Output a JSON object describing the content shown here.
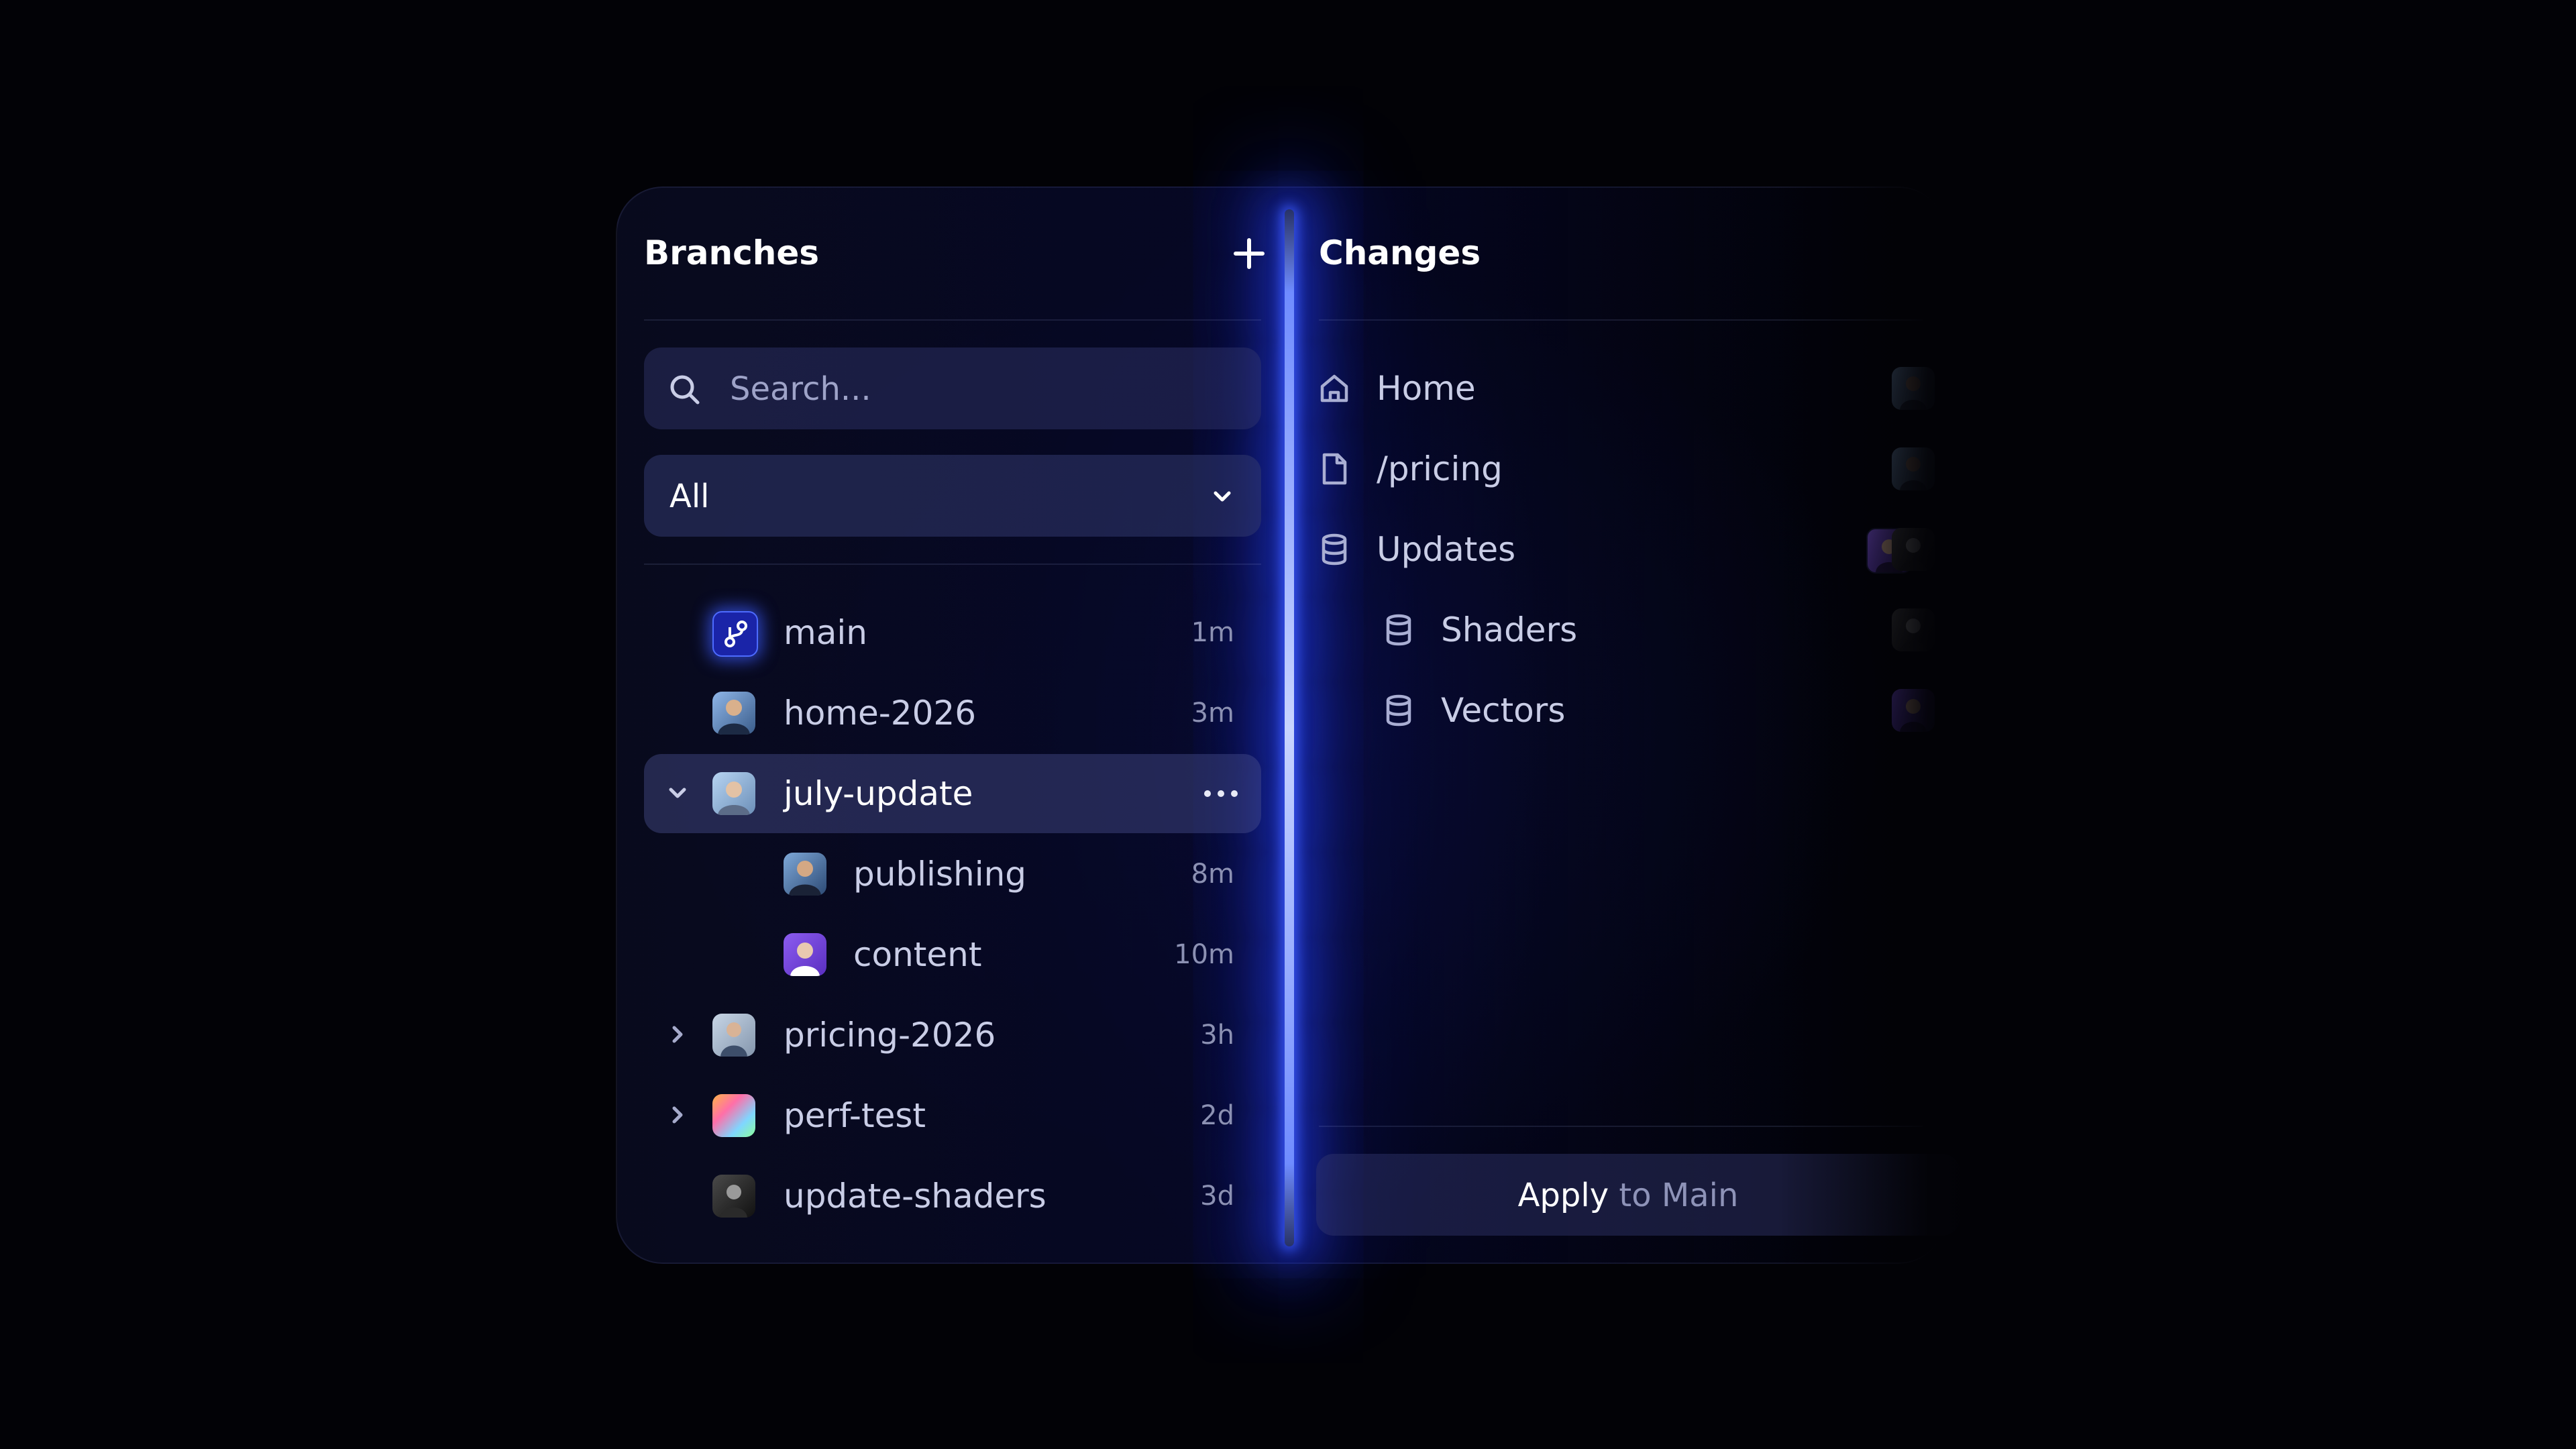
{
  "colors": {
    "accent_glow": "#3b5bff",
    "panel_bg": "#0a0c22",
    "text_primary": "#ffffff",
    "text_muted": "#8c91b3"
  },
  "branches": {
    "title": "Branches",
    "add_icon": "plus-icon",
    "search": {
      "placeholder": "Search...",
      "icon": "search-icon"
    },
    "filter": {
      "selected": "All",
      "icon": "chevron-down-icon"
    },
    "items": [
      {
        "label": "main",
        "time": "1m",
        "icon": "branch-icon"
      },
      {
        "label": "home-2026",
        "time": "3m"
      },
      {
        "label": "july-update",
        "expanded": true,
        "selected": true,
        "menu_icon": "more-icon"
      },
      {
        "label": "publishing",
        "time": "8m"
      },
      {
        "label": "content",
        "time": "10m"
      },
      {
        "label": "pricing-2026",
        "time": "3h",
        "expanded": false
      },
      {
        "label": "perf-test",
        "time": "2d",
        "expanded": false
      },
      {
        "label": "update-shaders",
        "time": "3d"
      }
    ]
  },
  "changes": {
    "title": "Changes",
    "items": [
      {
        "label": "Home",
        "icon": "home-icon"
      },
      {
        "label": "/pricing",
        "icon": "file-icon"
      },
      {
        "label": "Updates",
        "icon": "database-icon"
      },
      {
        "label": "Shaders",
        "icon": "database-icon"
      },
      {
        "label": "Vectors",
        "icon": "database-icon"
      }
    ],
    "apply": {
      "strong": "Apply",
      "soft": " to Main"
    }
  }
}
